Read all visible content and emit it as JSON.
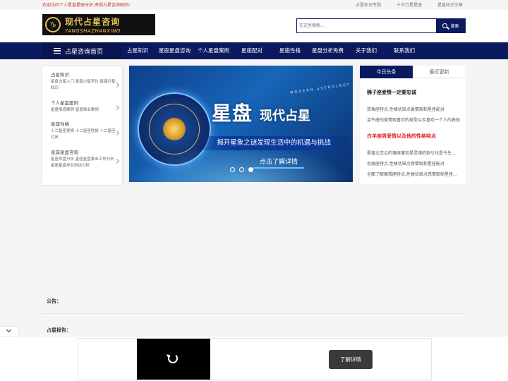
{
  "topbar": {
    "welcome": "欢迎访问个人星盘星座分析,央视占星咨询网站!",
    "links": [
      "占星知识专题",
      "十大行星星座",
      "星盘知识文章"
    ]
  },
  "logo": {
    "cn": "现代占星咨询",
    "en": "YANGSHAZHANXING"
  },
  "search": {
    "placeholder": "在这里搜索...",
    "button": "搜索"
  },
  "nav": {
    "home": "占星咨询首页",
    "items": [
      "占星知识",
      "星座星盘咨询",
      "个人星盘案例",
      "星座配对",
      "星座性格",
      "星盘分析免费",
      "关于我们",
      "联系我们"
    ]
  },
  "categories": [
    {
      "title": "占星知识",
      "sub": "星盘占星入门 星盘占星宫位 星盘行星知识"
    },
    {
      "title": "个人星盘案例",
      "sub": "星盘情感案例 星盘事业案例"
    },
    {
      "title": "星座性格",
      "sub": "十二星座爱情 十二星座性格 十二星座讨厌"
    },
    {
      "title": "星座星盘咨询",
      "sub": "星座命盘分析 星座星盘事业工作分析 星座星盘学业财运分析"
    }
  ],
  "banner": {
    "modern": "MODERN ASTROLOGY",
    "big": "星盘",
    "big2": "现代占星",
    "tagline": "揭开星象之谜发现生活中的机遇与挑战",
    "cta": "点击了解详情"
  },
  "news": {
    "tabs": [
      "今日头条",
      "最近更新"
    ],
    "headline1": "狮子座爱情一定要忠诚",
    "group1": [
      "双鱼座特点,性格优缺点爱情观和星座配对",
      "金牛座的爱情观喜欢的类型以及喜欢一个人的表现"
    ],
    "headline2": "白羊座男爱情以及他的性格特点",
    "group2": [
      "星盘北交点的落座落宫是灵魂的指引也是今生的课题",
      "水瓶座特点,性格优缺点感情观和星座配对",
      "全面了解摩羯座特点,性格优缺点感情观和星座配对"
    ]
  },
  "notice": "公告：",
  "report": "占星报告：",
  "ad": {
    "button": "了解详情"
  },
  "colors": {
    "navy": "#0b1a5e",
    "accent_red": "#c0392b"
  }
}
